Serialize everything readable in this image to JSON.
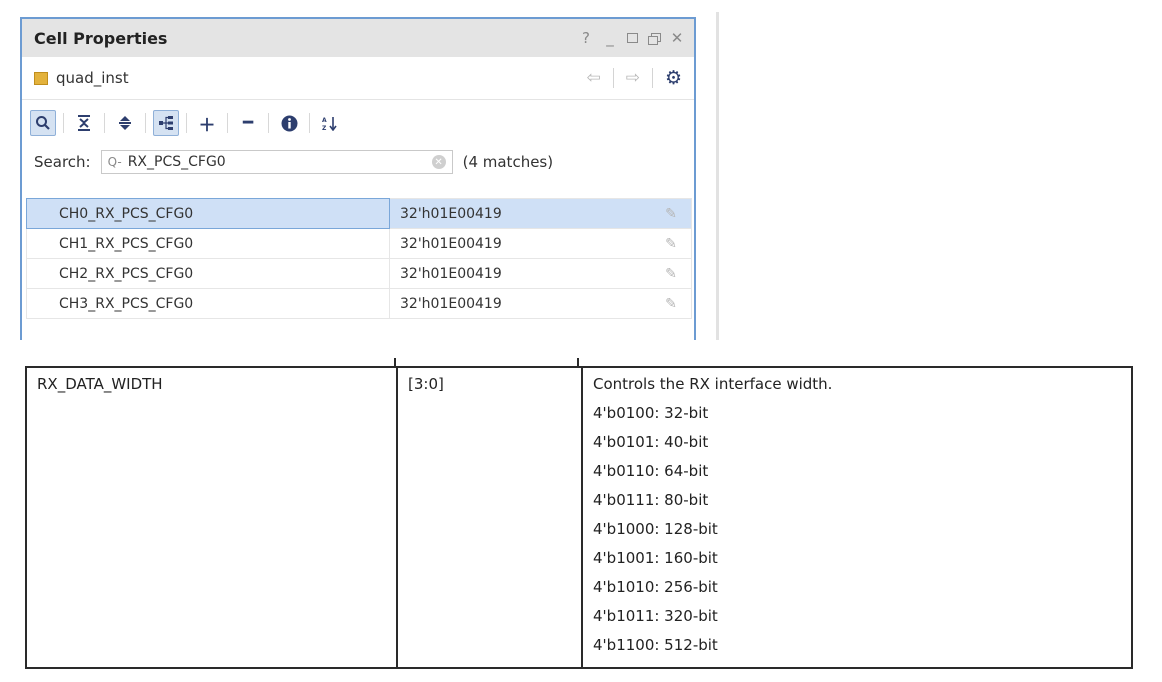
{
  "panel": {
    "title": "Cell Properties",
    "window_controls": [
      "?",
      "_"
    ],
    "object_name": "quad_inst",
    "search": {
      "label": "Search:",
      "value": "RX_PCS_CFG0",
      "prefix_glyph": "Q-",
      "matches": "(4 matches)"
    },
    "rows": [
      {
        "name": "CH0_RX_PCS_CFG0",
        "value": "32'h01E00419",
        "selected": true
      },
      {
        "name": "CH1_RX_PCS_CFG0",
        "value": "32'h01E00419",
        "selected": false
      },
      {
        "name": "CH2_RX_PCS_CFG0",
        "value": "32'h01E00419",
        "selected": false
      },
      {
        "name": "CH3_RX_PCS_CFG0",
        "value": "32'h01E00419",
        "selected": false
      }
    ]
  },
  "attribute": {
    "name": "RX_DATA_WIDTH",
    "bits": "[3:0]",
    "description": "Controls the RX interface width.",
    "options": [
      "4'b0100: 32-bit",
      "4'b0101: 40-bit",
      "4'b0110: 64-bit",
      "4'b0111: 80-bit",
      "4'b1000: 128-bit",
      "4'b1001: 160-bit",
      "4'b1010: 256-bit",
      "4'b1011: 320-bit",
      "4'b1100: 512-bit"
    ]
  },
  "colors": {
    "panel_border": "#6c9bd2",
    "selection": "#cfe0f6",
    "icon_blue": "#2d3e6e",
    "cell_icon": "#e3b23c"
  }
}
